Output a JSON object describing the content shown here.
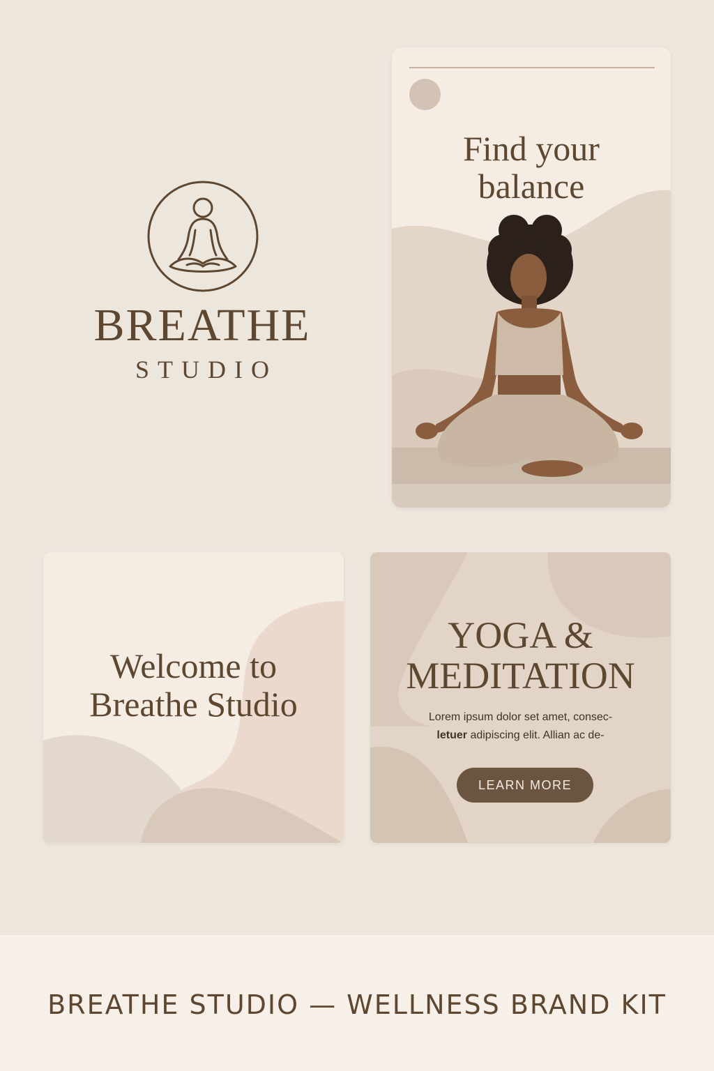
{
  "brand": {
    "wordmark": "BREATHE",
    "sub": "STUDIO",
    "emblem_icon": "meditating-figure-icon"
  },
  "story_card": {
    "headline_line1": "Find your",
    "headline_line2": "balance",
    "photo": "meditating-woman-photo"
  },
  "welcome_card": {
    "line1": "Welcome to",
    "line2": "Breathe Studio"
  },
  "yoga_card": {
    "title_line1": "YOGA &",
    "title_line2": "MEDITATION",
    "body_line1": "Lorem ipsum dolor set amet, consec-",
    "body_line2_bold": "letuer",
    "body_line2_rest": " adipiscing elit. Allian ac de-",
    "button_label": "LEARN MORE"
  },
  "footer": {
    "title": "BREATHE STUDIO — WELLNESS BRAND KIT"
  },
  "colors": {
    "background": "#ece6dd",
    "card_cream": "#f5ece3",
    "brown": "#5e4731",
    "button_brown": "#6b5440",
    "beige_shape": "#e2d5c8",
    "tan_shape": "#d6c7b8"
  }
}
